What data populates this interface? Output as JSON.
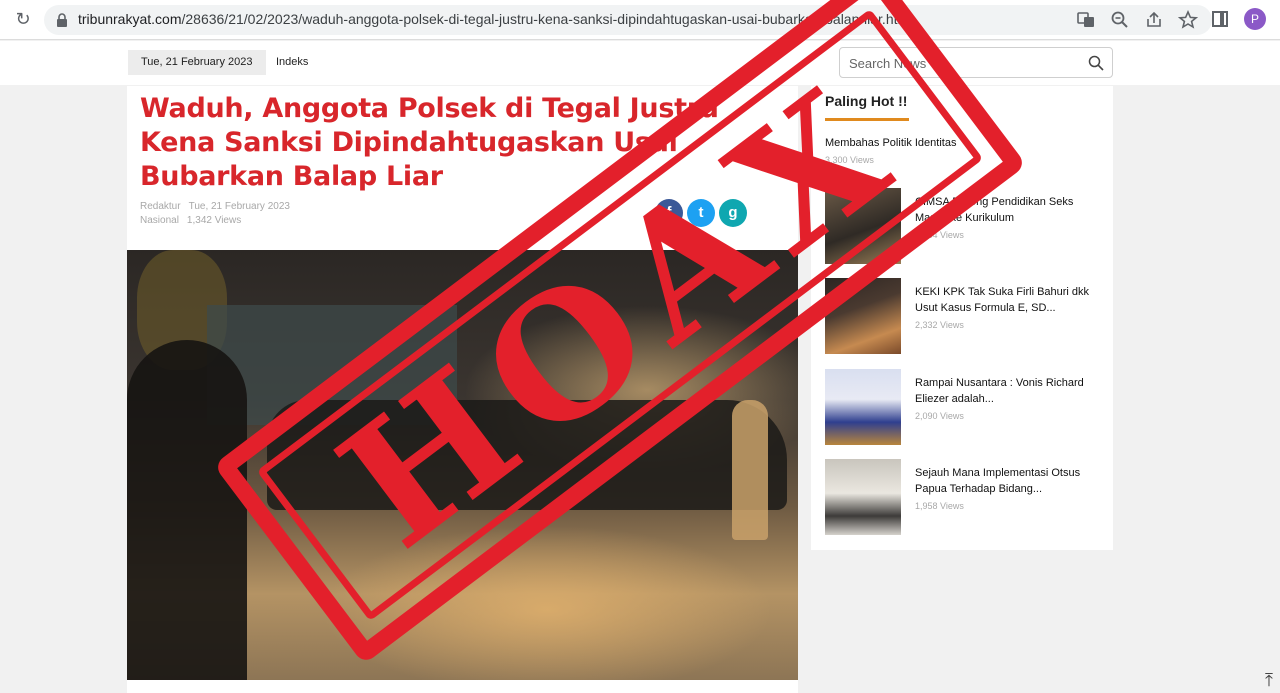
{
  "browser": {
    "url_domain": "tribunrakyat.com",
    "url_path": "/28636/21/02/2023/waduh-anggota-polsek-di-tegal-justru-kena-sanksi-dipindahtugaskan-usai-bubarkan-balap-liar.html",
    "profile_initial": "P"
  },
  "header": {
    "date": "Tue, 21 February 2023",
    "indeks": "Indeks",
    "search_placeholder": "Search News"
  },
  "article": {
    "title": "Waduh, Anggota Polsek di Tegal Justru Kena Sanksi Dipindahtugaskan Usai Bubarkan Balap Liar",
    "author_label": "Redaktur",
    "date": "Tue, 21 February 2023",
    "category": "Nasional",
    "views": "1,342 Views",
    "share": {
      "facebook": "f",
      "twitter": "t",
      "other": "g"
    }
  },
  "sidebar": {
    "title": "Paling Hot !!",
    "first": {
      "title": "Membahas Politik Identitas",
      "views": "3,300 Views"
    },
    "items": [
      {
        "title": "CIMSA Dorong Pendidikan Seks Masuk ke Kurikulum",
        "views": "2,684 Views"
      },
      {
        "title": "KEKI KPK Tak Suka Firli Bahuri dkk Usut Kasus Formula E, SD...",
        "views": "2,332 Views"
      },
      {
        "title": "Rampai Nusantara : Vonis Richard Eliezer adalah...",
        "views": "2,090 Views"
      },
      {
        "title": "Sejauh Mana Implementasi Otsus Papua Terhadap Bidang...",
        "views": "1,958 Views"
      }
    ]
  },
  "overlay": {
    "stamp_text": "HOAX",
    "color": "#e3202b"
  },
  "colors": {
    "title_red": "#d8262b",
    "accent_orange": "#e08a1e"
  }
}
